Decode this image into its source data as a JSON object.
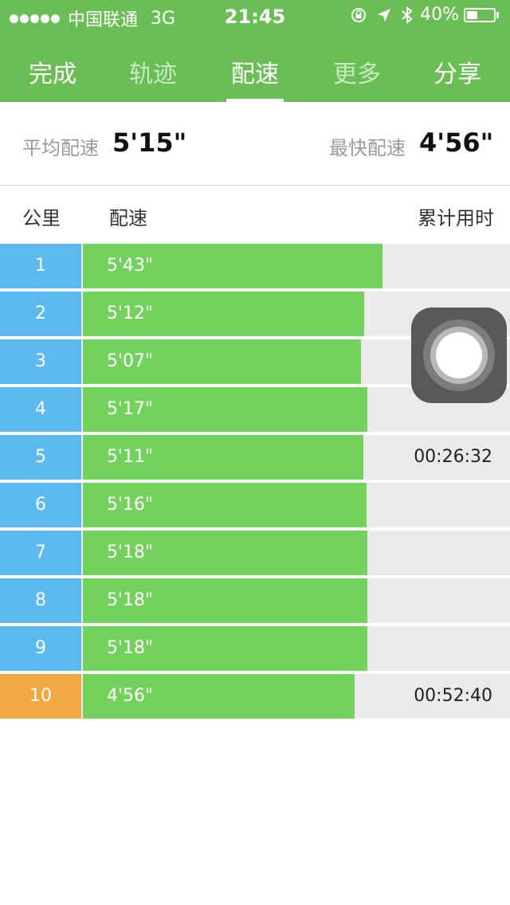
{
  "status_bar": {
    "carrier": "中国联通",
    "network": "3G",
    "time": "21:45",
    "battery": "40%",
    "battery_level": 0.4,
    "icons": [
      "signal-dots",
      "orientation-lock-icon",
      "location-arrow-icon",
      "bluetooth-icon",
      "battery-icon"
    ]
  },
  "tabs": [
    {
      "label": "完成"
    },
    {
      "label": "轨迹"
    },
    {
      "label": "配速"
    },
    {
      "label": "更多"
    },
    {
      "label": "分享"
    }
  ],
  "summary": {
    "avg_label": "平均配速",
    "avg_value": "5'15\"",
    "fast_label": "最快配速",
    "fast_value": "4'56\""
  },
  "columns": {
    "km": "公里",
    "pace": "配速",
    "cumulative": "累计用时"
  },
  "rows": [
    {
      "km": "1",
      "pace": "5'43\"",
      "cumulative": ""
    },
    {
      "km": "2",
      "pace": "5'12\"",
      "cumulative": ""
    },
    {
      "km": "3",
      "pace": "5'07\"",
      "cumulative": ""
    },
    {
      "km": "4",
      "pace": "5'17\"",
      "cumulative": ""
    },
    {
      "km": "5",
      "pace": "5'11\"",
      "cumulative": "00:26:32"
    },
    {
      "km": "6",
      "pace": "5'16\"",
      "cumulative": ""
    },
    {
      "km": "7",
      "pace": "5'18\"",
      "cumulative": ""
    },
    {
      "km": "8",
      "pace": "5'18\"",
      "cumulative": ""
    },
    {
      "km": "9",
      "pace": "5'18\"",
      "cumulative": ""
    },
    {
      "km": "10",
      "pace": "4'56\"",
      "cumulative": "00:52:40"
    }
  ],
  "colors": {
    "header_green": "#6bbd56",
    "km_blue": "#5cb9ee",
    "fastest_orange": "#f2a744",
    "bar_green": "#75d15d",
    "track_gray": "#ebe9ea"
  }
}
